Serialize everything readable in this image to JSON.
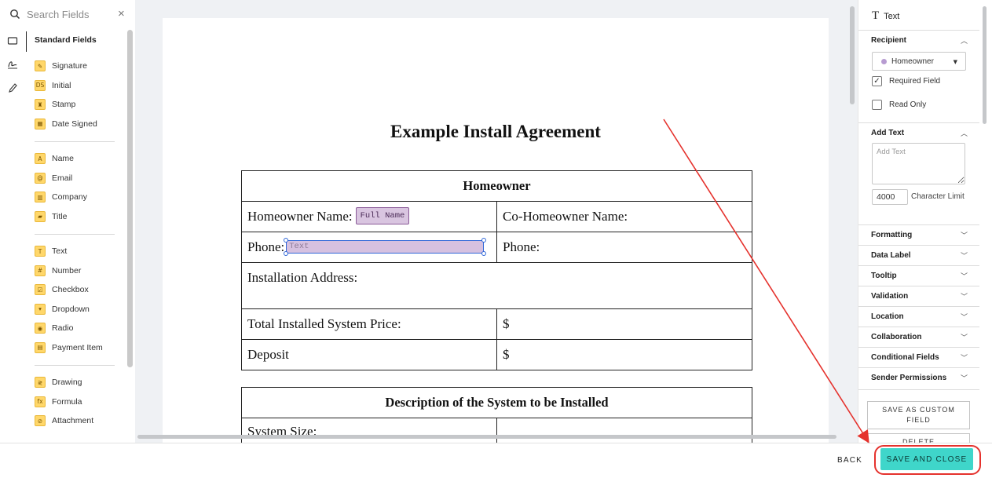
{
  "search": {
    "placeholder": "Search Fields",
    "clear_symbol": "×"
  },
  "tool_rail": {
    "icons": [
      "square-icon",
      "signature-tool-icon",
      "pen-icon"
    ]
  },
  "field_groups": [
    {
      "title": "Standard Fields",
      "items": [
        {
          "label": "Signature",
          "glyph": "✎",
          "icon": "signature-icon"
        },
        {
          "label": "Initial",
          "glyph": "DS",
          "icon": "initial-icon"
        },
        {
          "label": "Stamp",
          "glyph": "♜",
          "icon": "stamp-icon"
        },
        {
          "label": "Date Signed",
          "glyph": "▦",
          "icon": "date-signed-icon"
        }
      ]
    },
    {
      "items": [
        {
          "label": "Name",
          "glyph": "A",
          "icon": "name-icon"
        },
        {
          "label": "Email",
          "glyph": "@",
          "icon": "email-icon"
        },
        {
          "label": "Company",
          "glyph": "▥",
          "icon": "company-icon"
        },
        {
          "label": "Title",
          "glyph": "▰",
          "icon": "title-icon"
        }
      ]
    },
    {
      "items": [
        {
          "label": "Text",
          "glyph": "T",
          "icon": "text-icon"
        },
        {
          "label": "Number",
          "glyph": "#",
          "icon": "number-icon"
        },
        {
          "label": "Checkbox",
          "glyph": "☑",
          "icon": "checkbox-icon"
        },
        {
          "label": "Dropdown",
          "glyph": "▾",
          "icon": "dropdown-icon"
        },
        {
          "label": "Radio",
          "glyph": "◉",
          "icon": "radio-icon"
        },
        {
          "label": "Payment Item",
          "glyph": "▤",
          "icon": "payment-item-icon"
        }
      ]
    },
    {
      "items": [
        {
          "label": "Drawing",
          "glyph": "≷",
          "icon": "drawing-icon"
        },
        {
          "label": "Formula",
          "glyph": "fx",
          "icon": "formula-icon"
        },
        {
          "label": "Attachment",
          "glyph": "⊘",
          "icon": "attachment-icon"
        }
      ]
    }
  ],
  "document": {
    "title": "Example Install Agreement",
    "homeowner_table": {
      "header": "Homeowner",
      "homeowner_name_label": "Homeowner Name:",
      "full_name_tag": "Full Name",
      "co_homeowner_label": "Co-Homeowner Name:",
      "phone_label": "Phone:",
      "text_tag": "Text",
      "phone_label_2": "Phone:",
      "installation_address_label": "Installation Address:",
      "total_price_label": "Total Installed System Price:",
      "total_price_value": "$",
      "deposit_label": "Deposit",
      "deposit_value": "$"
    },
    "system_table": {
      "header": "Description of the System to be Installed",
      "system_size_label": "System Size:"
    }
  },
  "properties": {
    "field_type": "Text",
    "recipient": {
      "heading": "Recipient",
      "selected": "Homeowner",
      "recipient_color": "#b79bd1",
      "required_label": "Required Field",
      "required_checked": true,
      "read_only_label": "Read Only",
      "read_only_checked": false
    },
    "add_text": {
      "heading": "Add Text",
      "placeholder": "Add Text",
      "character_limit": "4000",
      "character_limit_label": "Character Limit"
    },
    "sections": [
      "Formatting",
      "Data Label",
      "Tooltip",
      "Validation",
      "Location",
      "Collaboration",
      "Conditional Fields",
      "Sender Permissions"
    ],
    "save_custom_label": "SAVE AS CUSTOM FIELD",
    "delete_label": "DELETE"
  },
  "footer": {
    "back_label": "BACK",
    "save_close_label": "SAVE AND CLOSE",
    "accent_color": "#3fd6ca",
    "annotation_color": "#e5322d"
  }
}
